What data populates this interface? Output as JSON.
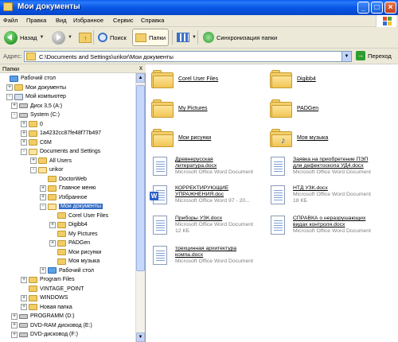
{
  "window": {
    "title": "Мои документы"
  },
  "menu": [
    "Файл",
    "Правка",
    "Вид",
    "Избранное",
    "Сервис",
    "Справка"
  ],
  "toolbar": {
    "back_label": "Назад",
    "search_label": "Поиск",
    "folders_label": "Папки",
    "sync_label": "Синхронизация папки"
  },
  "address": {
    "label": "Адрес:",
    "path": "C:\\Documents and Settings\\urikor\\Мои документы",
    "go_label": "Переход"
  },
  "folder_pane": {
    "title": "Папки",
    "close": "x",
    "tree": [
      {
        "label": "Рабочий стол",
        "expander": "",
        "icon": "desk"
      },
      {
        "label": "Мои документы",
        "expander": "+",
        "icon": "folder"
      },
      {
        "label": "Мой компьютер",
        "expander": "-",
        "icon": "pc"
      },
      {
        "label": "Диск 3,5 (A:)",
        "expander": "+",
        "icon": "drive"
      },
      {
        "label": "System (C:)",
        "expander": "-",
        "icon": "drive"
      },
      {
        "label": "0",
        "expander": "+",
        "icon": "folder"
      },
      {
        "label": "1a4232cc87fe48f77b497",
        "expander": "+",
        "icon": "folder"
      },
      {
        "label": "C6M",
        "expander": "+",
        "icon": "folder"
      },
      {
        "label": "Documents and Settings",
        "expander": "-",
        "icon": "folder-open"
      },
      {
        "label": "All Users",
        "expander": "+",
        "icon": "folder"
      },
      {
        "label": "urikor",
        "expander": "-",
        "icon": "folder-open"
      },
      {
        "label": "DoctorWeb",
        "expander": "",
        "icon": "folder"
      },
      {
        "label": "Главное меню",
        "expander": "+",
        "icon": "folder"
      },
      {
        "label": "Избранное",
        "expander": "+",
        "icon": "folder"
      },
      {
        "label": "Мои документы",
        "expander": "-",
        "icon": "folder-open"
      },
      {
        "label": "Corel User Files",
        "expander": "",
        "icon": "folder"
      },
      {
        "label": "Digibb4",
        "expander": "+",
        "icon": "folder"
      },
      {
        "label": "My Pictures",
        "expander": "",
        "icon": "folder"
      },
      {
        "label": "PADGen",
        "expander": "+",
        "icon": "folder"
      },
      {
        "label": "Мои рисунки",
        "expander": "",
        "icon": "folder"
      },
      {
        "label": "Моя музыка",
        "expander": "",
        "icon": "folder"
      },
      {
        "label": "Рабочий стол",
        "expander": "+",
        "icon": "desk"
      },
      {
        "label": "Program Files",
        "expander": "+",
        "icon": "folder"
      },
      {
        "label": "VINTAGE_POINT",
        "expander": "",
        "icon": "folder"
      },
      {
        "label": "WINDOWS",
        "expander": "+",
        "icon": "folder"
      },
      {
        "label": "Новая папка",
        "expander": "+",
        "icon": "folder"
      },
      {
        "label": "PROGRAMM (D:)",
        "expander": "+",
        "icon": "drive"
      },
      {
        "label": "DVD-RAM дисковод (E:)",
        "expander": "+",
        "icon": "drive"
      },
      {
        "label": "DVD-дисковод (F:)",
        "expander": "+",
        "icon": "drive"
      }
    ]
  },
  "content": {
    "folders": [
      {
        "label": "Corel User Files"
      },
      {
        "label": "Digibb4"
      },
      {
        "label": "My Pictures"
      },
      {
        "label": "PADGen"
      },
      {
        "label": "Мои рисунки"
      },
      {
        "label": "Моя музыка"
      }
    ],
    "documents": [
      {
        "name1": "Древнерусская",
        "name2": "литература.docx",
        "type": "Microsoft Office Word Document",
        "size": ""
      },
      {
        "name1": "Заявка на приобретение ПЭП",
        "name2": "для дефектоскопа УД4.docx",
        "type": "Microsoft Office Word Document",
        "size": ""
      },
      {
        "name1": "КОРРЕКТИРУЮЩИЕ",
        "name2": "УПРАЖНЕНИЯ.doc",
        "type": "Microsoft Office Word 97 - 20...",
        "size": ""
      },
      {
        "name1": "НТД УЗК.docx",
        "name2": "",
        "type": "Microsoft Office Word Document",
        "size": "18 КБ"
      },
      {
        "name1": "Приборы УЗК.docx",
        "name2": "",
        "type": "Microsoft Office Word Document",
        "size": "12 КБ"
      },
      {
        "name1": "СПРАВКА о неразрушающих",
        "name2": "видах контроля.docx",
        "type": "Microsoft Office Word Document",
        "size": ""
      },
      {
        "name1": "трехцинная архитектура",
        "name2": "компа.docx",
        "type": "Microsoft Office Word Document",
        "size": ""
      }
    ]
  }
}
